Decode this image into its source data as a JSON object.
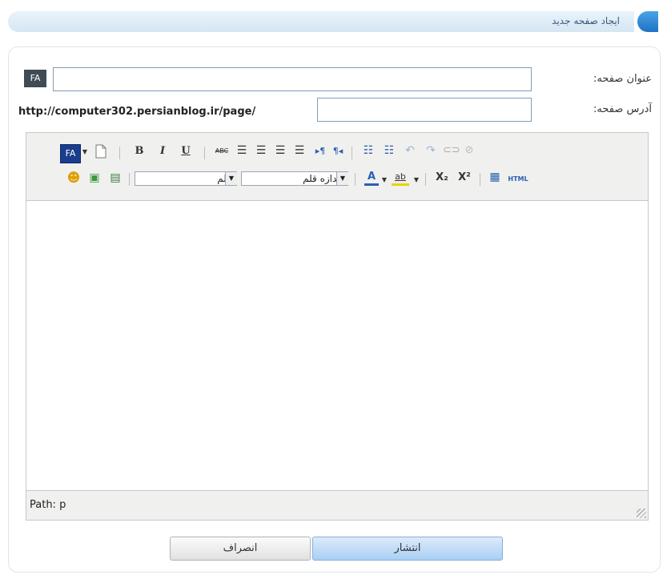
{
  "header": {
    "title": "ایجاد صفحه جدید"
  },
  "form": {
    "title_label": "عنوان صفحه:",
    "title_value": "",
    "address_label": "آدرس صفحه:",
    "address_value": "",
    "url_prefix": "http://computer302.persianblog.ir/page/",
    "lang_badge": "FA"
  },
  "editor": {
    "toolbar_row1": {
      "lang_button": "FA",
      "bold": "B",
      "italic": "I",
      "underline": "U",
      "strike": "ABC"
    },
    "toolbar_row2": {
      "font_select": "قلم",
      "size_select": "اندازه قلم",
      "font_color": "A",
      "bg_color": "ab",
      "subscript": "X₂",
      "superscript": "X²",
      "html": "HTML"
    },
    "status_path": "Path: p"
  },
  "actions": {
    "publish": "انتشار",
    "cancel": "انصراف"
  },
  "colors": {
    "accent": "#1f73c4",
    "header_bg": "#d6e6f3",
    "toolbar_bg": "#f0f0ee"
  }
}
